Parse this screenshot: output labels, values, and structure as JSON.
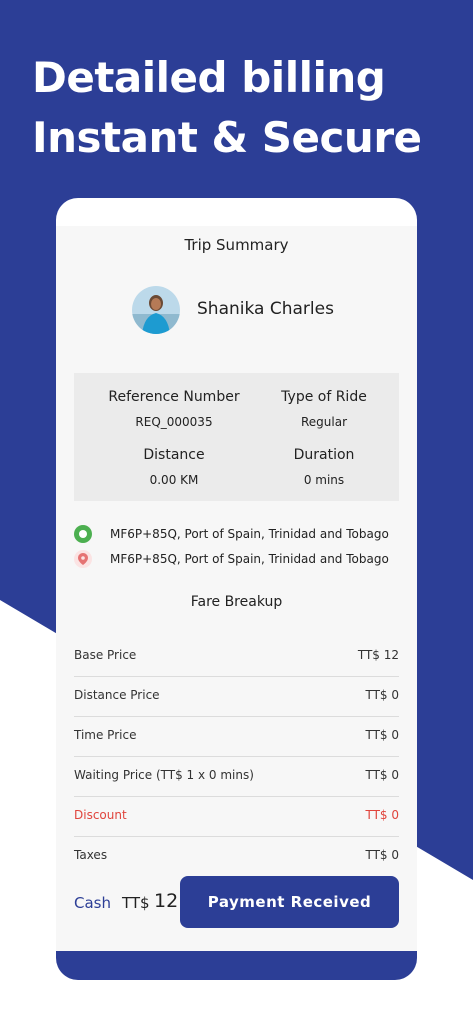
{
  "headline": {
    "line1": "Detailed billing",
    "line2": "Instant & Secure"
  },
  "colors": {
    "brand": "#2c3e96",
    "discount": "#e0443c",
    "pickup": "#4caf50",
    "drop": "#e57373"
  },
  "summary": {
    "title": "Trip Summary",
    "rider_name": "Shanika Charles",
    "reference_label": "Reference Number",
    "reference_value": "REQ_000035",
    "ride_type_label": "Type of Ride",
    "ride_type_value": "Regular",
    "distance_label": "Distance",
    "distance_value": "0.00 KM",
    "duration_label": "Duration",
    "duration_value": "0 mins"
  },
  "locations": {
    "pickup": "MF6P+85Q, Port of Spain, Trinidad and Tobago",
    "drop": "MF6P+85Q, Port of Spain, Trinidad and Tobago"
  },
  "fare": {
    "title": "Fare Breakup",
    "rows": [
      {
        "label": "Base Price",
        "value": "TT$ 12"
      },
      {
        "label": "Distance Price",
        "value": "TT$ 0"
      },
      {
        "label": "Time Price",
        "value": "TT$ 0"
      },
      {
        "label": "Waiting Price (TT$ 1 x 0 mins)",
        "value": "TT$ 0"
      },
      {
        "label": "Discount",
        "value": "TT$ 0"
      },
      {
        "label": "Taxes",
        "value": "TT$ 0"
      }
    ]
  },
  "payment": {
    "method": "Cash",
    "currency": "TT$",
    "amount": "12",
    "button_label": "Payment Received"
  }
}
